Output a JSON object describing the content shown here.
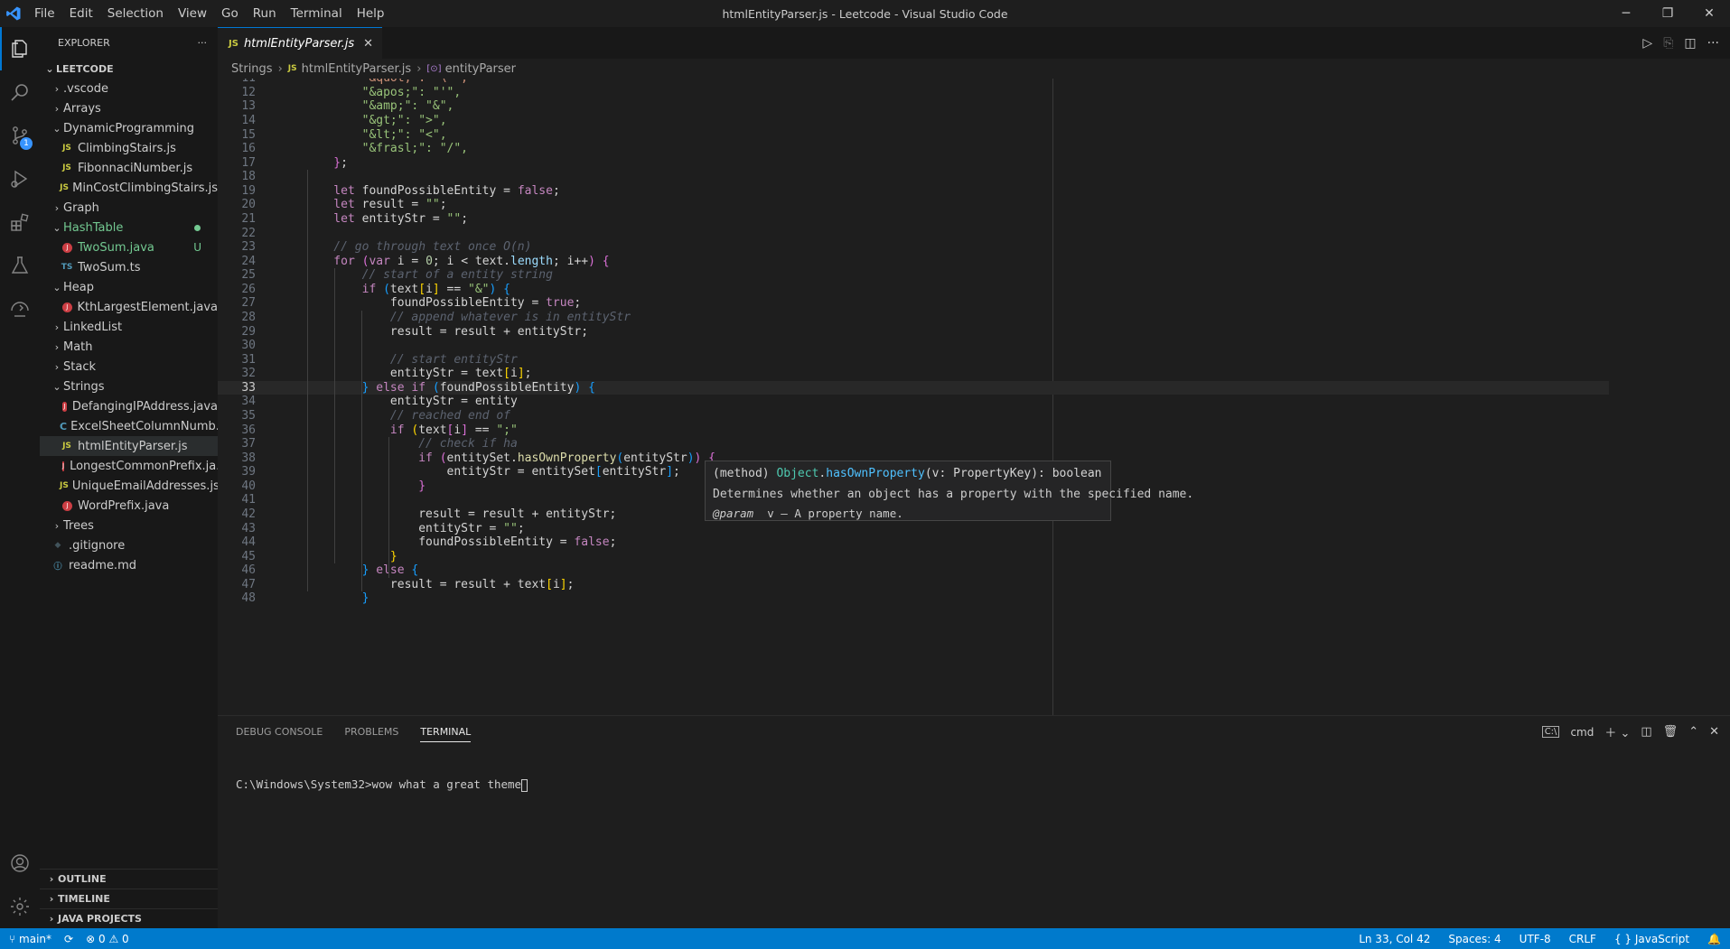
{
  "window": {
    "title": "htmlEntityParser.js - Leetcode - Visual Studio Code",
    "menu": [
      "File",
      "Edit",
      "Selection",
      "View",
      "Go",
      "Run",
      "Terminal",
      "Help"
    ]
  },
  "activity_bar": {
    "items": [
      "explorer-icon",
      "search-icon",
      "source-control-icon",
      "run-debug-icon",
      "extensions-icon",
      "testing-icon",
      "remote-icon"
    ],
    "scm_badge": "1",
    "bottom": [
      "account-icon",
      "settings-gear-icon"
    ]
  },
  "explorer": {
    "title": "EXPLORER",
    "more": "···",
    "root": "LEETCODE",
    "tree": [
      {
        "label": ".vscode",
        "type": "folder",
        "depth": 1,
        "open": false
      },
      {
        "label": "Arrays",
        "type": "folder",
        "depth": 1,
        "open": false
      },
      {
        "label": "DynamicProgramming",
        "type": "folder",
        "depth": 1,
        "open": true
      },
      {
        "label": "ClimbingStairs.js",
        "type": "js",
        "depth": 2
      },
      {
        "label": "FibonnaciNumber.js",
        "type": "js",
        "depth": 2
      },
      {
        "label": "MinCostClimbingStairs.js",
        "type": "js",
        "depth": 2
      },
      {
        "label": "Graph",
        "type": "folder",
        "depth": 1,
        "open": false
      },
      {
        "label": "HashTable",
        "type": "folder",
        "depth": 1,
        "open": true,
        "modified": "dot"
      },
      {
        "label": "TwoSum.java",
        "type": "java",
        "depth": 2,
        "modified": "U"
      },
      {
        "label": "TwoSum.ts",
        "type": "ts",
        "depth": 2
      },
      {
        "label": "Heap",
        "type": "folder",
        "depth": 1,
        "open": true
      },
      {
        "label": "KthLargestElement.java",
        "type": "java",
        "depth": 2
      },
      {
        "label": "LinkedList",
        "type": "folder",
        "depth": 1,
        "open": false
      },
      {
        "label": "Math",
        "type": "folder",
        "depth": 1,
        "open": false
      },
      {
        "label": "Stack",
        "type": "folder",
        "depth": 1,
        "open": false
      },
      {
        "label": "Strings",
        "type": "folder",
        "depth": 1,
        "open": true
      },
      {
        "label": "DefangingIPAddress.java",
        "type": "java",
        "depth": 2
      },
      {
        "label": "ExcelSheetColumnNumb...",
        "type": "c",
        "depth": 2
      },
      {
        "label": "htmlEntityParser.js",
        "type": "js",
        "depth": 2,
        "selected": true
      },
      {
        "label": "LongestCommonPrefix.ja...",
        "type": "java",
        "depth": 2
      },
      {
        "label": "UniqueEmailAddresses.js",
        "type": "js",
        "depth": 2
      },
      {
        "label": "WordPrefix.java",
        "type": "java",
        "depth": 2
      },
      {
        "label": "Trees",
        "type": "folder",
        "depth": 1,
        "open": false
      },
      {
        "label": ".gitignore",
        "type": "git",
        "depth": 1
      },
      {
        "label": "readme.md",
        "type": "info",
        "depth": 1
      }
    ],
    "sections": [
      "OUTLINE",
      "TIMELINE",
      "JAVA PROJECTS"
    ]
  },
  "tab": {
    "label": "htmlEntityParser.js",
    "icon_text": "JS",
    "close": "✕"
  },
  "breadcrumb": {
    "folder": "Strings",
    "file": "htmlEntityParser.js",
    "symbol": "entityParser",
    "file_icon": "JS",
    "symbol_icon": "[⊙]"
  },
  "editor": {
    "current_line": 33,
    "lines": [
      {
        "n": "11",
        "t": [
          [
            "s",
            "        \"&quot;\": \"\\\"\","
          ]
        ]
      },
      {
        "n": "12",
        "t": [
          [
            "s2",
            "        \"&apos;\": \"'\","
          ]
        ]
      },
      {
        "n": "13",
        "t": [
          [
            "s2",
            "        \"&amp;\": \"&\","
          ]
        ]
      },
      {
        "n": "14",
        "t": [
          [
            "s2",
            "        \"&gt;\": \">\","
          ]
        ]
      },
      {
        "n": "15",
        "t": [
          [
            "s2",
            "        \"&lt;\": \"<\","
          ]
        ]
      },
      {
        "n": "16",
        "t": [
          [
            "s2",
            "        \"&frasl;\": \"/\","
          ]
        ]
      },
      {
        "n": "17",
        "t": [
          [
            "p2",
            "    }"
          ],
          [
            "o",
            ";"
          ]
        ]
      },
      {
        "n": "18",
        "t": []
      },
      {
        "n": "19",
        "t": [
          [
            "k",
            "    let "
          ],
          [
            "o",
            "foundPossibleEntity = "
          ],
          [
            "k",
            "false"
          ],
          [
            "o",
            ";"
          ]
        ]
      },
      {
        "n": "20",
        "t": [
          [
            "k",
            "    let "
          ],
          [
            "o",
            "result = "
          ],
          [
            "s2",
            "\"\""
          ],
          [
            "o",
            ";"
          ]
        ]
      },
      {
        "n": "21",
        "t": [
          [
            "k",
            "    let "
          ],
          [
            "o",
            "entityStr = "
          ],
          [
            "s2",
            "\"\""
          ],
          [
            "o",
            ";"
          ]
        ]
      },
      {
        "n": "22",
        "t": []
      },
      {
        "n": "23",
        "t": [
          [
            "c2",
            "    // go through text once O(n)"
          ]
        ]
      },
      {
        "n": "24",
        "t": [
          [
            "k",
            "    for "
          ],
          [
            "p2",
            "("
          ],
          [
            "k",
            "var "
          ],
          [
            "o",
            "i = "
          ],
          [
            "n",
            "0"
          ],
          [
            "o",
            "; i < text."
          ],
          [
            "v",
            "length"
          ],
          [
            "o",
            "; i++"
          ],
          [
            "p2",
            ")"
          ],
          [
            "o",
            " "
          ],
          [
            "p2",
            "{"
          ]
        ]
      },
      {
        "n": "25",
        "t": [
          [
            "c2",
            "        // start of a entity string"
          ]
        ]
      },
      {
        "n": "26",
        "t": [
          [
            "k",
            "        if "
          ],
          [
            "p3",
            "("
          ],
          [
            "o",
            "text"
          ],
          [
            "p1",
            "["
          ],
          [
            "o",
            "i"
          ],
          [
            "p1",
            "]"
          ],
          [
            "o",
            " == "
          ],
          [
            "s2",
            "\"&\""
          ],
          [
            "p3",
            ")"
          ],
          [
            "o",
            " "
          ],
          [
            "p3",
            "{"
          ]
        ]
      },
      {
        "n": "27",
        "t": [
          [
            "o",
            "            foundPossibleEntity = "
          ],
          [
            "k",
            "true"
          ],
          [
            "o",
            ";"
          ]
        ]
      },
      {
        "n": "28",
        "t": [
          [
            "c2",
            "            // append whatever is in entityStr"
          ]
        ]
      },
      {
        "n": "29",
        "t": [
          [
            "o",
            "            result = result + entityStr;"
          ]
        ]
      },
      {
        "n": "30",
        "t": []
      },
      {
        "n": "31",
        "t": [
          [
            "c2",
            "            // start entityStr"
          ]
        ]
      },
      {
        "n": "32",
        "t": [
          [
            "o",
            "            entityStr = text"
          ],
          [
            "p1",
            "["
          ],
          [
            "o",
            "i"
          ],
          [
            "p1",
            "]"
          ],
          [
            "o",
            ";"
          ]
        ]
      },
      {
        "n": "33",
        "t": [
          [
            "p3",
            "        }"
          ],
          [
            "k",
            " else if "
          ],
          [
            "p3",
            "("
          ],
          [
            "o",
            "foundPossibleEntity"
          ],
          [
            "p3",
            ")"
          ],
          [
            "o",
            " "
          ],
          [
            "p3",
            "{"
          ]
        ]
      },
      {
        "n": "34",
        "t": [
          [
            "o",
            "            entityStr = entity"
          ]
        ]
      },
      {
        "n": "35",
        "t": [
          [
            "c2",
            "            // reached end of"
          ]
        ]
      },
      {
        "n": "36",
        "t": [
          [
            "k",
            "            if "
          ],
          [
            "p1",
            "("
          ],
          [
            "o",
            "text"
          ],
          [
            "p2",
            "["
          ],
          [
            "o",
            "i"
          ],
          [
            "p2",
            "]"
          ],
          [
            "o",
            " == "
          ],
          [
            "s2",
            "\";\""
          ]
        ]
      },
      {
        "n": "37",
        "t": [
          [
            "c2",
            "                // check if ha"
          ]
        ]
      },
      {
        "n": "38",
        "t": [
          [
            "k",
            "                if "
          ],
          [
            "p2",
            "("
          ],
          [
            "o",
            "entitySet."
          ],
          [
            "f",
            "hasOwnProperty"
          ],
          [
            "p3",
            "("
          ],
          [
            "o",
            "entityStr"
          ],
          [
            "p3",
            ")"
          ],
          [
            "p2",
            ")"
          ],
          [
            "o",
            " "
          ],
          [
            "p2",
            "{"
          ]
        ]
      },
      {
        "n": "39",
        "t": [
          [
            "o",
            "                    entityStr = entitySet"
          ],
          [
            "p3",
            "["
          ],
          [
            "o",
            "entityStr"
          ],
          [
            "p3",
            "]"
          ],
          [
            "o",
            ";"
          ]
        ]
      },
      {
        "n": "40",
        "t": [
          [
            "p2",
            "                }"
          ]
        ]
      },
      {
        "n": "41",
        "t": []
      },
      {
        "n": "42",
        "t": [
          [
            "o",
            "                result = result + entityStr;"
          ]
        ]
      },
      {
        "n": "43",
        "t": [
          [
            "o",
            "                entityStr = "
          ],
          [
            "s2",
            "\"\""
          ],
          [
            "o",
            ";"
          ]
        ]
      },
      {
        "n": "44",
        "t": [
          [
            "o",
            "                foundPossibleEntity = "
          ],
          [
            "k",
            "false"
          ],
          [
            "o",
            ";"
          ]
        ]
      },
      {
        "n": "45",
        "t": [
          [
            "p1",
            "            }"
          ]
        ]
      },
      {
        "n": "46",
        "t": [
          [
            "p3",
            "        }"
          ],
          [
            "k",
            " else "
          ],
          [
            "p3",
            "{"
          ]
        ]
      },
      {
        "n": "47",
        "t": [
          [
            "o",
            "            result = result + text"
          ],
          [
            "p1",
            "["
          ],
          [
            "o",
            "i"
          ],
          [
            "p1",
            "]"
          ],
          [
            "o",
            ";"
          ]
        ]
      },
      {
        "n": "48",
        "t": [
          [
            "p3",
            "        }"
          ]
        ]
      }
    ]
  },
  "hover": {
    "kind": "(method)",
    "object": "Object",
    "method": "hasOwnProperty",
    "params": "(v: PropertyKey): boolean",
    "description": "Determines whether an object has a property with the specified name.",
    "param_tag": "@param",
    "param_name": "v",
    "param_desc": "— A property name."
  },
  "panel": {
    "tabs": [
      "DEBUG CONSOLE",
      "PROBLEMS",
      "TERMINAL"
    ],
    "active_tab": "TERMINAL",
    "shell": "cmd",
    "terminal_line": "C:\\Windows\\System32>wow what a great theme"
  },
  "status": {
    "branch": "main*",
    "sync": "⟳",
    "errors": "0",
    "warnings": "0",
    "position": "Ln 33, Col 42",
    "spaces": "Spaces: 4",
    "encoding": "UTF-8",
    "eol": "CRLF",
    "language": "JavaScript",
    "language_icon": "{ }"
  },
  "colors": {
    "accent": "#007acc",
    "bg": "#1e1e1e",
    "sidebar": "#181818"
  }
}
